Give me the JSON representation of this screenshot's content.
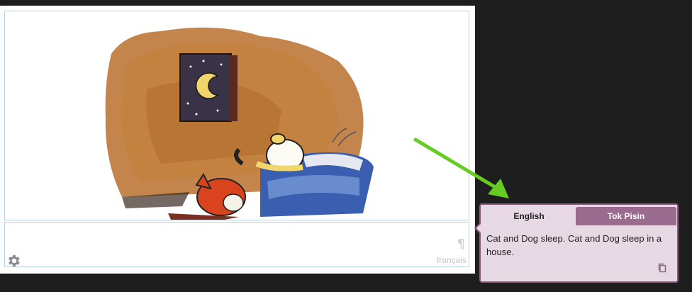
{
  "page": {
    "language_label": "français",
    "pilcrow": "¶"
  },
  "bubble": {
    "tabs": [
      {
        "label": "English",
        "active": true
      },
      {
        "label": "Tok Pisin",
        "active": false
      }
    ],
    "text": "Cat and Dog sleep. Cat and Dog sleep in a house."
  },
  "icons": {
    "settings": "gear-icon",
    "copy": "copy-icon"
  },
  "colors": {
    "arrow": "#66cc22",
    "bubble_bg": "#e7d9e3",
    "bubble_border": "#8a5a80",
    "tab_inactive": "#9a6a8f"
  }
}
